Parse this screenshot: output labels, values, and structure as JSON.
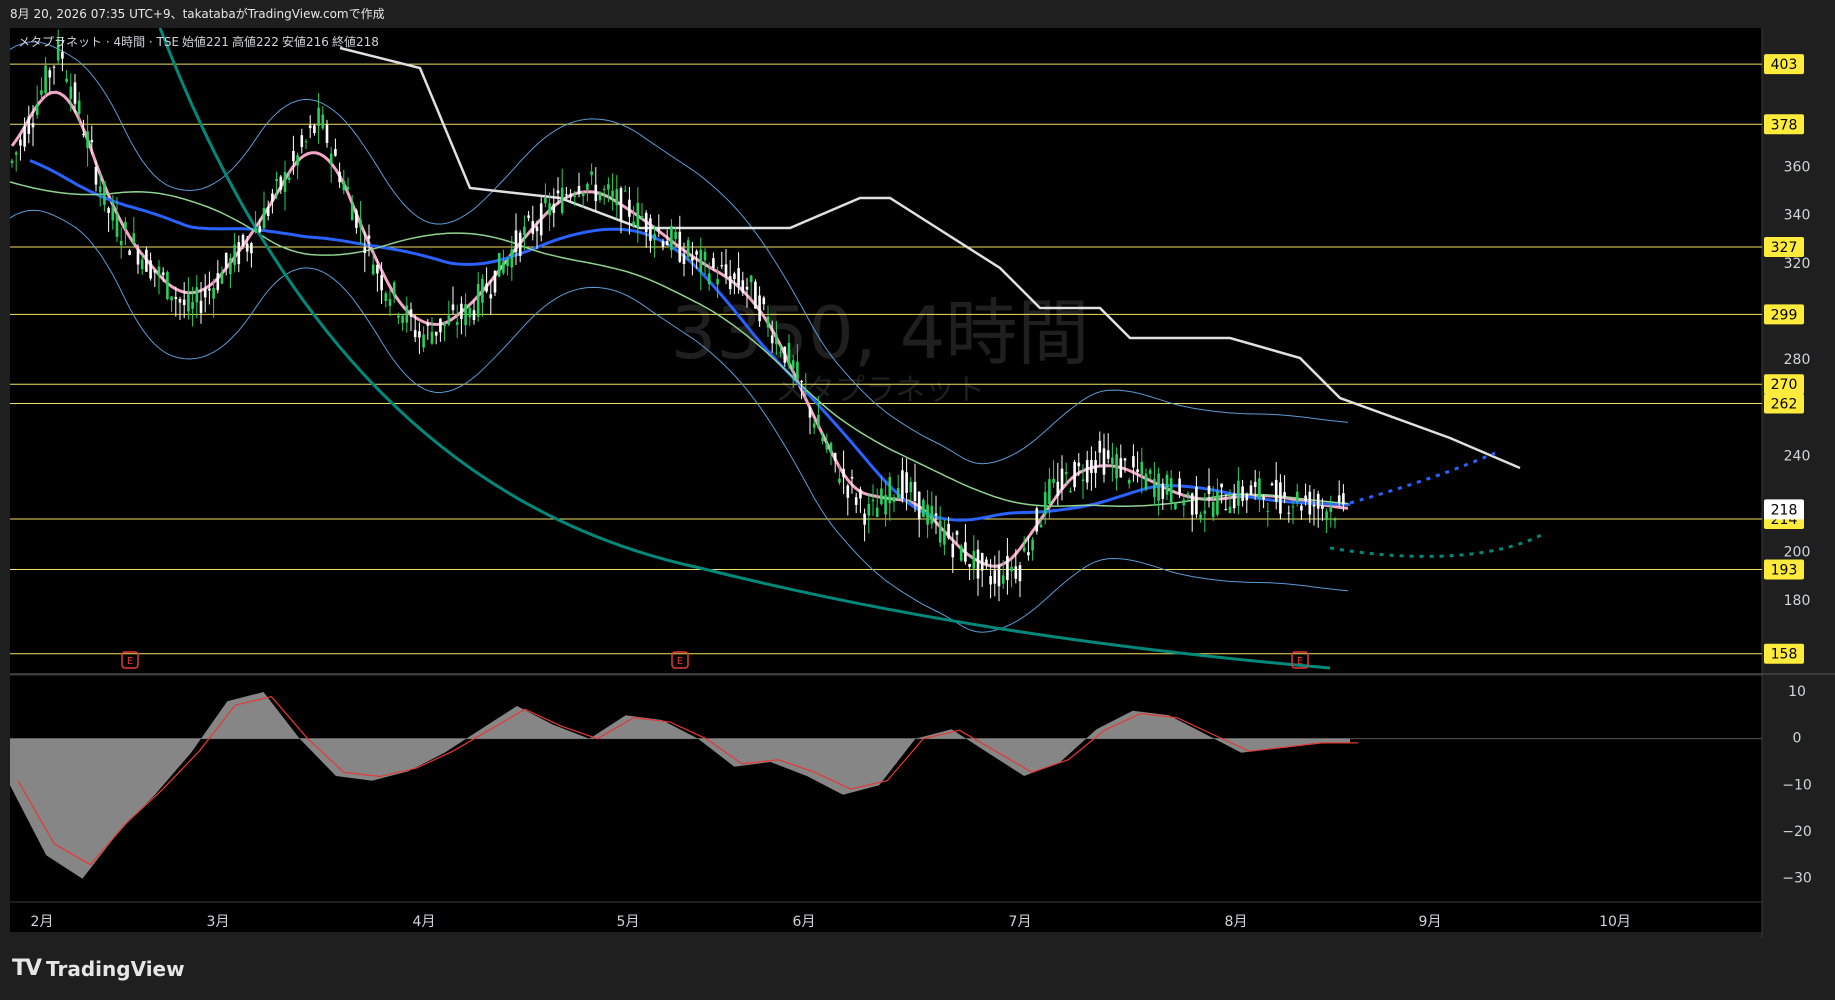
{
  "header": {
    "timestamp_text": "8月 20, 2026 07:35 UTC+9、takatabaがTradingView.comで作成"
  },
  "legend": {
    "symbol": "メタプラネット · 4時間 · TSE",
    "open_label": "始値",
    "open": "221",
    "high_label": "高値",
    "high": "222",
    "low_label": "安値",
    "low": "216",
    "close_label": "終値",
    "close": "218"
  },
  "watermark": {
    "line1": "3350, 4時間",
    "line2": "メタプラネット"
  },
  "brand": {
    "name": "TradingView",
    "mark": "TV"
  },
  "colors": {
    "background": "#000000",
    "frame": "#1f1f1f",
    "candle_up": "#26d15b",
    "candle_down": "#ffffff",
    "hline": "#f0e060",
    "price_badge_bg": "#ffeb3b",
    "last_badge_bg": "#ffffff",
    "ma_fast": "#f4a6c6",
    "ma_mid": "#2962ff",
    "ma_long": "#8fd38f",
    "ma_vlong": "#00897b",
    "bands": "#5b9bd5",
    "resistance_step": "#e0e0e0",
    "osc_fill": "#9e9e9e",
    "osc_signal": "#e53935",
    "earnings_marker": "#e53935"
  },
  "chart_data": {
    "type": "candlestick",
    "price_axis": {
      "ticks": [
        "360",
        "340",
        "320",
        "280",
        "240",
        "200",
        "180"
      ],
      "tick_values": [
        360,
        340,
        320,
        280,
        240,
        200,
        180
      ],
      "ylim": [
        150,
        418
      ]
    },
    "x_axis": {
      "ticks": [
        "2月",
        "3月",
        "4月",
        "5月",
        "6月",
        "7月",
        "8月",
        "9月",
        "10月"
      ]
    },
    "horizontal_levels": [
      {
        "label": "403",
        "value": 403
      },
      {
        "label": "378",
        "value": 378
      },
      {
        "label": "327",
        "value": 327
      },
      {
        "label": "299",
        "value": 299
      },
      {
        "label": "270",
        "value": 270
      },
      {
        "label": "262",
        "value": 262
      },
      {
        "label": "214",
        "value": 214
      },
      {
        "label": "193",
        "value": 193
      },
      {
        "label": "158",
        "value": 158
      }
    ],
    "last_price": {
      "label": "218",
      "value": 218
    },
    "events": [
      {
        "label": "E",
        "month_position": "2月"
      },
      {
        "label": "E",
        "month_position": "5月"
      },
      {
        "label": "E",
        "month_position": "8月"
      }
    ],
    "price_series_approx": {
      "months": [
        "2月",
        "3月",
        "4月",
        "5月",
        "6月",
        "7月",
        "8月"
      ],
      "close": [
        360,
        310,
        300,
        345,
        265,
        198,
        218
      ]
    },
    "oscillator": {
      "ticks": [
        "10",
        "0",
        "−10",
        "−20",
        "−30"
      ],
      "tick_values": [
        10,
        0,
        -10,
        -20,
        -30
      ],
      "ylim": [
        -35,
        13
      ],
      "values_approx": [
        -10,
        -25,
        -30,
        -20,
        -12,
        -3,
        8,
        10,
        0,
        -8,
        -9,
        -7,
        -3,
        2,
        7,
        3,
        0,
        5,
        4,
        0,
        -6,
        -5,
        -8,
        -12,
        -10,
        0,
        2,
        -3,
        -8,
        -5,
        2,
        6,
        5,
        1,
        -3,
        -2,
        -1,
        -1
      ]
    }
  }
}
